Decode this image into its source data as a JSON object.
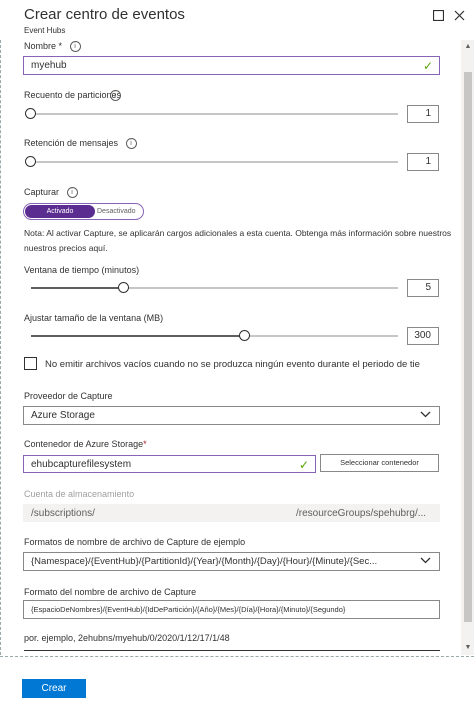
{
  "window": {
    "title": "Crear centro de eventos",
    "subtitle": "Event Hubs"
  },
  "fields": {
    "name": {
      "label": "Nombre",
      "required": "*",
      "value": "myehub"
    },
    "partitions": {
      "label": "Recuento de particiones",
      "value": "1",
      "level": 0.0
    },
    "retention": {
      "label": "Retención de mensajes",
      "value": "1",
      "level": 0.0
    },
    "capture": {
      "label": "Capturar",
      "on_label": "Activado",
      "off_label": "Desactivado",
      "state": "on"
    },
    "note": "Nota: Al activar Capture, se aplicarán cargos adicionales a esta cuenta. Obtenga más información sobre nuestros nuestros precios aquí.",
    "time_window": {
      "label": "Ventana de tiempo (minutos)",
      "value": "5",
      "level": 0.25
    },
    "size_window": {
      "label": "Ajustar tamaño de la ventana (MB)",
      "value": "300",
      "level": 0.58
    },
    "empty_files": {
      "label": "No emitir archivos vacíos cuando no se produzca ningún evento durante el periodo de tie",
      "checked": false
    },
    "provider": {
      "label": "Proveedor de Capture",
      "value": "Azure Storage"
    },
    "container": {
      "label": "Contenedor de Azure Storage",
      "required": "*",
      "value": "ehubcapturefilesystem",
      "button": "Seleccionar contenedor"
    },
    "storage_account": {
      "label": "Cuenta de almacenamiento",
      "value_left": "/subscriptions/",
      "value_right": "/resourceGroups/spehubrg/..."
    },
    "format_sample": {
      "label": "Formatos de nombre de archivo de Capture de ejemplo",
      "value": "{Namespace}/{EventHub}/{PartitionId}/{Year}/{Month}/{Day}/{Hour}/{Minute}/{Sec..."
    },
    "format": {
      "label": "Formato del nombre de archivo de Capture",
      "value": "{EspacioDeNombres}/{EventHub}/{IdDePartición}/{Año}/{Mes}/{Día}/{Hora}/{Minuto}/{Segundo}"
    },
    "example": "por. ejemplo, 2ehubns/myehub/0/2020/1/12/17/1/48"
  },
  "footer": {
    "create_label": "Crear"
  },
  "colors": {
    "accent": "#5c2d91",
    "primary": "#0078d4",
    "success": "#57a300"
  },
  "icons": [
    "info-icon",
    "check-icon",
    "chevron-down-icon",
    "maximize-icon",
    "close-icon"
  ]
}
